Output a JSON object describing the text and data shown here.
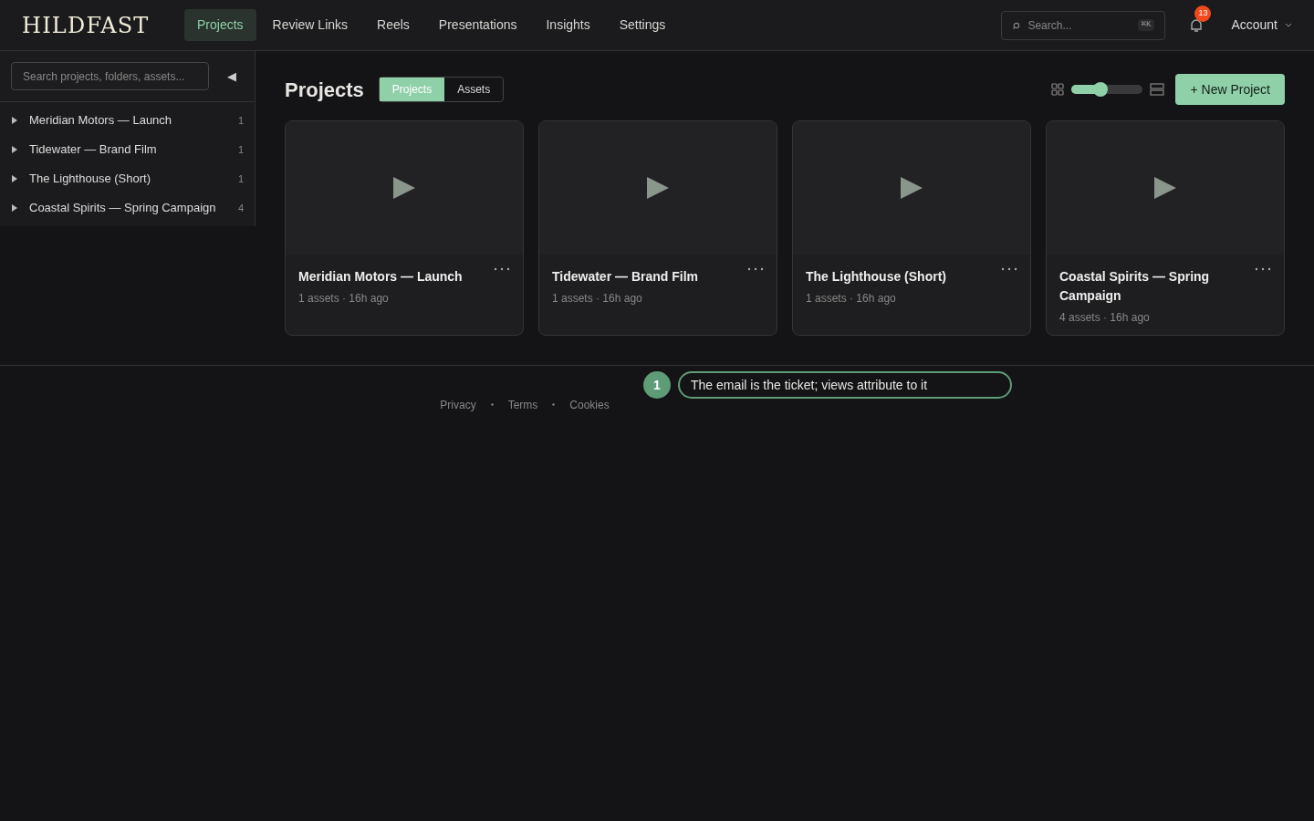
{
  "logo": "HILDFAST",
  "nav": [
    {
      "label": "Projects",
      "selected": true
    },
    {
      "label": "Review Links",
      "selected": false
    },
    {
      "label": "Reels",
      "selected": false
    },
    {
      "label": "Presentations",
      "selected": false
    },
    {
      "label": "Insights",
      "selected": false
    },
    {
      "label": "Settings",
      "selected": false
    }
  ],
  "header_search": {
    "placeholder": "Search...",
    "shortcut": "⌘K"
  },
  "notifications": {
    "count": "13"
  },
  "account": {
    "label": "Account"
  },
  "sidebar": {
    "search": {
      "placeholder": "Search projects, folders, assets..."
    },
    "collapse": "◀",
    "items": [
      {
        "label": "Meridian Motors — Launch",
        "count": "1",
        "expanded": false
      },
      {
        "label": "Tidewater — Brand Film",
        "count": "1",
        "expanded": false
      },
      {
        "label": "The Lighthouse (Short)",
        "count": "1",
        "expanded": false
      },
      {
        "label": "Coastal Spirits — Spring Campaign",
        "count": "4",
        "expanded": false
      }
    ]
  },
  "main": {
    "title": "Projects",
    "toggle": [
      {
        "label": "Projects",
        "selected": true
      },
      {
        "label": "Assets",
        "selected": false
      }
    ],
    "size_slider": {
      "level": 0.4
    },
    "new_button": "+ New Project",
    "cards": [
      {
        "title": "Meridian Motors — Launch",
        "meta": "1 assets · 16h ago"
      },
      {
        "title": "Tidewater — Brand Film",
        "meta": "1 assets · 16h ago"
      },
      {
        "title": "The Lighthouse (Short)",
        "meta": "1 assets · 16h ago"
      },
      {
        "title": "Coastal Spirits — Spring Campaign",
        "meta": "4 assets · 16h ago"
      }
    ]
  },
  "footer": [
    "Privacy",
    "Terms",
    "Cookies"
  ],
  "callout": {
    "number": "1",
    "text": "The email is the ticket; views attribute to it"
  }
}
